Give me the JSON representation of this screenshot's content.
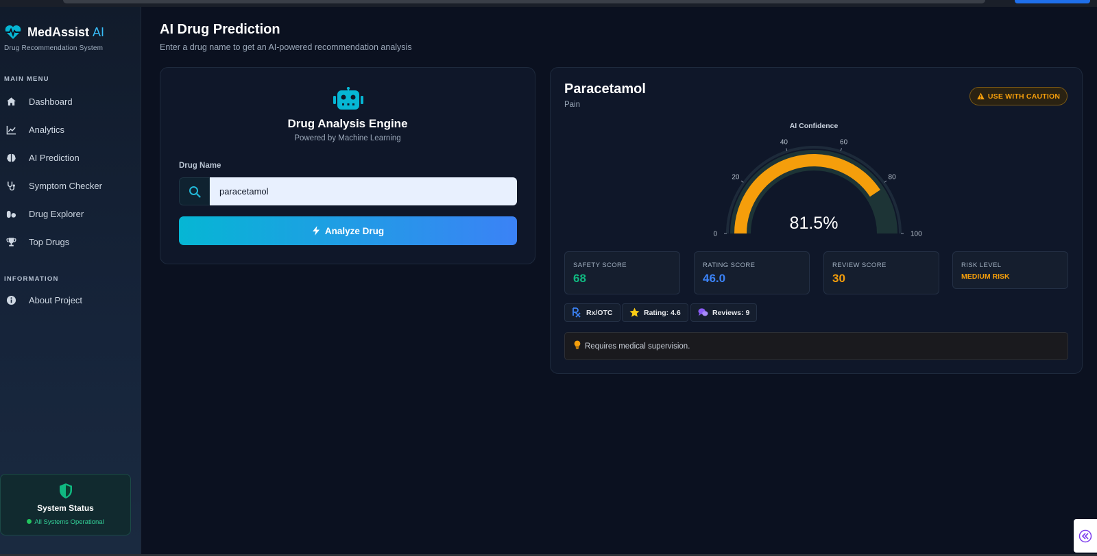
{
  "brand": {
    "name": "MedAssist",
    "suffix": "AI",
    "subtitle": "Drug Recommendation System"
  },
  "sidebar": {
    "main_menu_label": "MAIN MENU",
    "items": [
      {
        "label": "Dashboard",
        "icon": "home-icon"
      },
      {
        "label": "Analytics",
        "icon": "chart-line-icon"
      },
      {
        "label": "AI Prediction",
        "icon": "brain-icon"
      },
      {
        "label": "Symptom Checker",
        "icon": "stethoscope-icon"
      },
      {
        "label": "Drug Explorer",
        "icon": "pills-icon"
      },
      {
        "label": "Top Drugs",
        "icon": "trophy-icon"
      }
    ],
    "info_label": "INFORMATION",
    "info_items": [
      {
        "label": "About Project",
        "icon": "info-icon"
      }
    ],
    "status": {
      "title": "System Status",
      "text": "All Systems Operational"
    }
  },
  "page": {
    "title": "AI Drug Prediction",
    "subtitle": "Enter a drug name to get an AI-powered recommendation analysis"
  },
  "engine": {
    "title": "Drug Analysis Engine",
    "subtitle": "Powered by Machine Learning",
    "field_label": "Drug Name",
    "input_value": "paracetamol",
    "button_label": "Analyze Drug"
  },
  "result": {
    "drug_name": "Paracetamol",
    "category": "Pain",
    "badge": "USE WITH CAUTION",
    "gauge": {
      "title": "AI Confidence",
      "value": 81.5,
      "display": "81.5%",
      "ticks": [
        "0",
        "20",
        "40",
        "60",
        "80",
        "100"
      ]
    },
    "stats": [
      {
        "label": "SAFETY SCORE",
        "value": "68",
        "color": "#10b981"
      },
      {
        "label": "RATING SCORE",
        "value": "46.0",
        "color": "#3b82f6"
      },
      {
        "label": "REVIEW SCORE",
        "value": "30",
        "color": "#f59e0b"
      },
      {
        "label": "RISK LEVEL",
        "value": "MEDIUM RISK",
        "color": "#f59e0b"
      }
    ],
    "chips": [
      {
        "label": "Rx/OTC",
        "icon": "prescription-icon"
      },
      {
        "label": "Rating: 4.6",
        "icon": "star-icon"
      },
      {
        "label": "Reviews: 9",
        "icon": "comments-icon"
      }
    ],
    "note": "Requires medical supervision."
  },
  "colors": {
    "accent": "#06b6d4",
    "primary": "#3b82f6",
    "warning": "#f59e0b",
    "success": "#10b981"
  }
}
